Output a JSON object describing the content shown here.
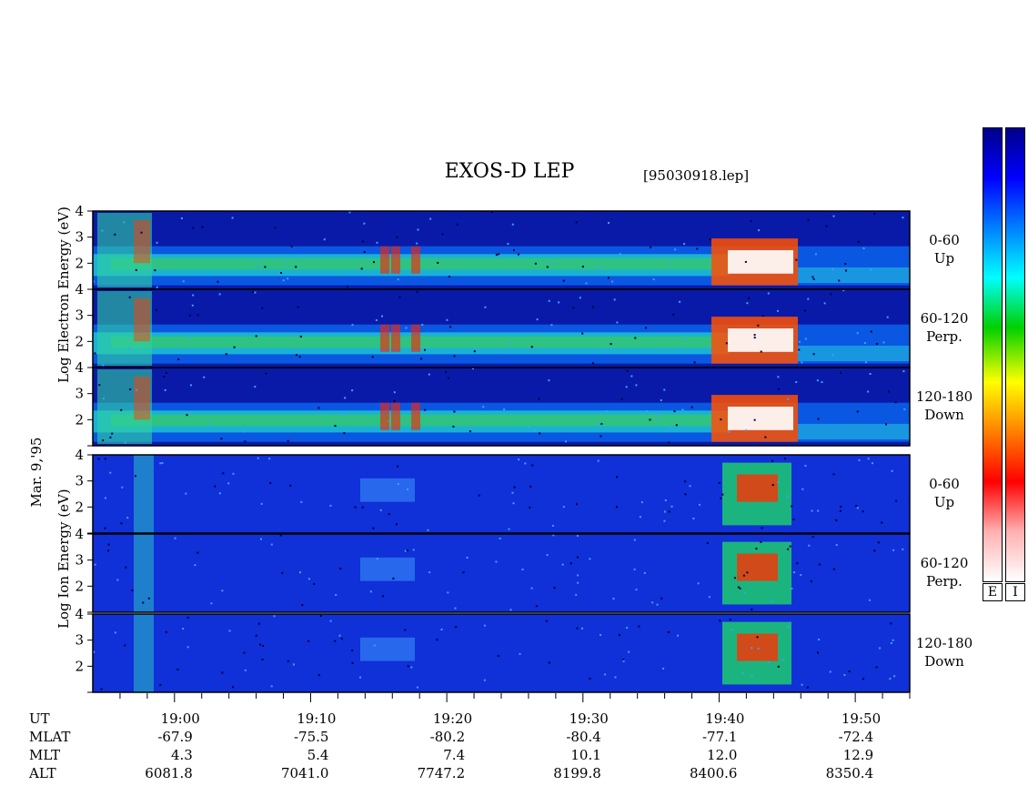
{
  "header": {
    "title": "EXOS-D LEP",
    "file": "[95030918.lep]"
  },
  "left_labels": {
    "date": "Mar. 9,'95",
    "electron": "Log Electron Energy (eV)",
    "ion": "Log Ion Energy (eV)"
  },
  "panels": [
    {
      "group": "electron",
      "pitch": "0-60",
      "dir": "Up"
    },
    {
      "group": "electron",
      "pitch": "60-120",
      "dir": "Perp."
    },
    {
      "group": "electron",
      "pitch": "120-180",
      "dir": "Down"
    },
    {
      "group": "ion",
      "pitch": "0-60",
      "dir": "Up"
    },
    {
      "group": "ion",
      "pitch": "60-120",
      "dir": "Perp."
    },
    {
      "group": "ion",
      "pitch": "120-180",
      "dir": "Down"
    }
  ],
  "colorbars": {
    "e_label": "E",
    "i_label": "I"
  },
  "chart_data": {
    "type": "heatmap",
    "x_unit": "UT",
    "x_range": [
      "18:54",
      "19:54"
    ],
    "y_range": [
      1,
      4
    ],
    "y_ticks": [
      2,
      3,
      4
    ],
    "x_ticks": [
      "19:00",
      "19:10",
      "19:20",
      "19:30",
      "19:40",
      "19:50"
    ],
    "ephemeris": {
      "rows": [
        {
          "name": "UT",
          "values": [
            "19:00",
            "19:10",
            "19:20",
            "19:30",
            "19:40",
            "19:50"
          ]
        },
        {
          "name": "MLAT",
          "values": [
            "-67.9",
            "-75.5",
            "-80.2",
            "-80.4",
            "-77.1",
            "-72.4"
          ]
        },
        {
          "name": "MLT",
          "values": [
            "4.3",
            "5.4",
            "7.4",
            "10.1",
            "12.0",
            "12.9"
          ]
        },
        {
          "name": "ALT",
          "values": [
            "6081.8",
            "7041.0",
            "7747.2",
            "8199.8",
            "8400.6",
            "8350.4"
          ]
        }
      ]
    },
    "colormap": [
      "#ffffff",
      "#ffb0b0",
      "#ff0000",
      "#ff8000",
      "#ffff00",
      "#00d000",
      "#00ffff",
      "#0080ff",
      "#0000ff",
      "#00008a"
    ]
  }
}
